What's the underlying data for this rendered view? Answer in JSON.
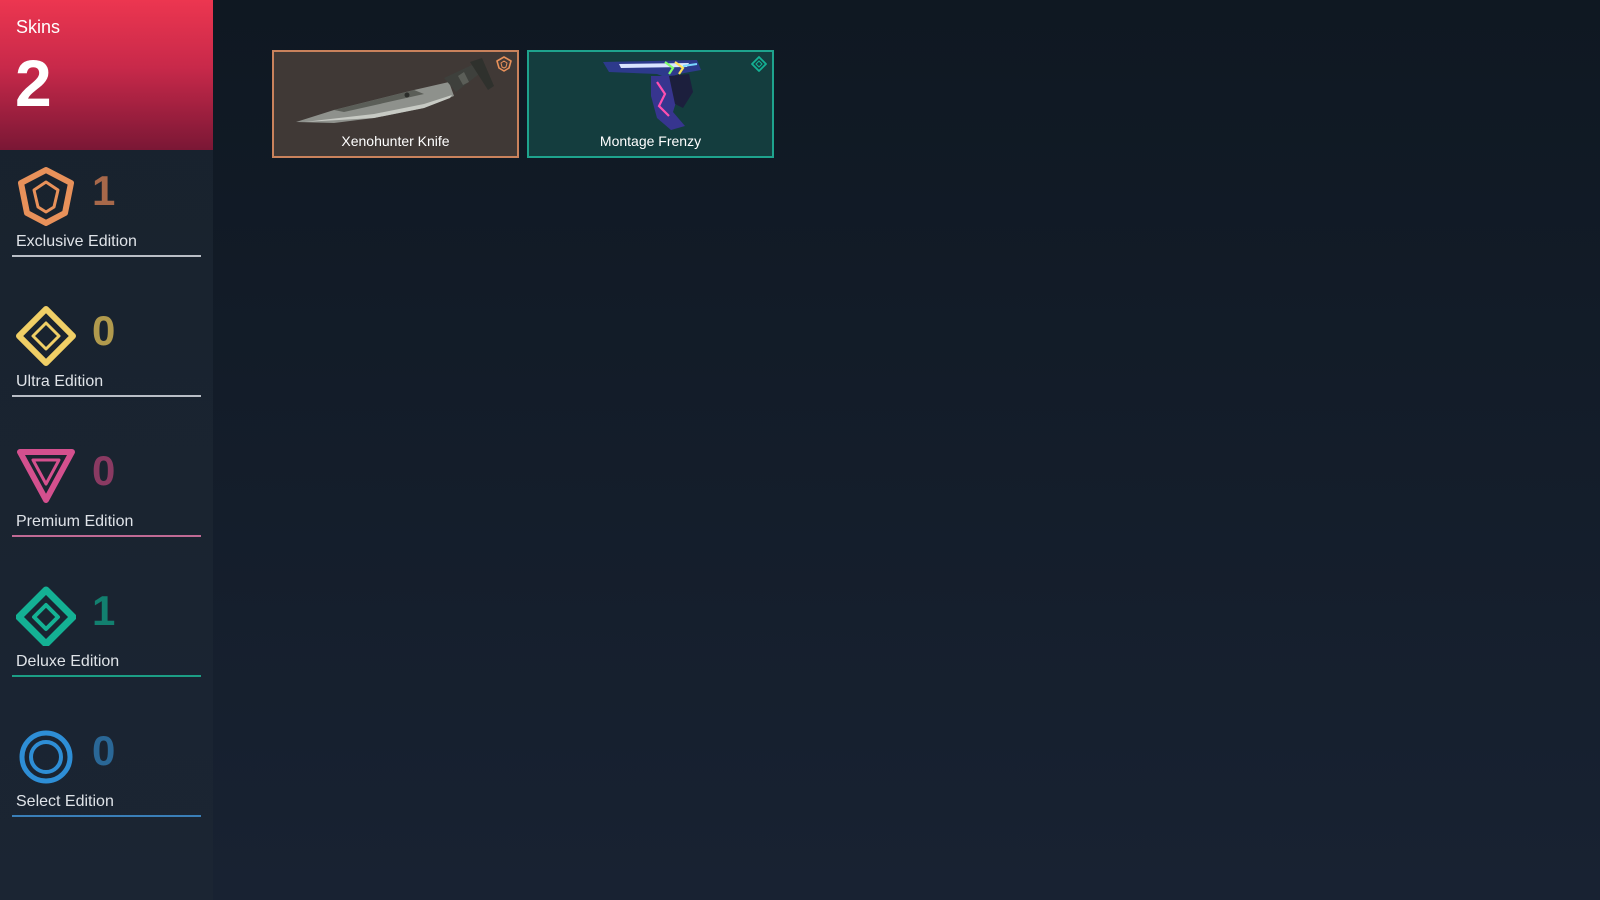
{
  "summary": {
    "label": "Skins",
    "count": "2"
  },
  "tiers": [
    {
      "label": "Exclusive Edition",
      "count": "1",
      "icon": "exclusive-edition-icon",
      "color": "#e8915a",
      "count_color": "#a7684a",
      "rule_color": "#b9bec6"
    },
    {
      "label": "Ultra Edition",
      "count": "0",
      "icon": "ultra-edition-icon",
      "color": "#f0cf66",
      "count_color": "#b19a4d",
      "rule_color": "#b9bec6"
    },
    {
      "label": "Premium Edition",
      "count": "0",
      "icon": "premium-edition-icon",
      "color": "#d4508e",
      "count_color": "#8a3a62",
      "rule_color": "#c06a94"
    },
    {
      "label": "Deluxe Edition",
      "count": "1",
      "icon": "deluxe-edition-icon",
      "color": "#14b194",
      "count_color": "#12806f",
      "rule_color": "#1c9e85"
    },
    {
      "label": "Select Edition",
      "count": "0",
      "icon": "select-edition-icon",
      "color": "#2e8ed6",
      "count_color": "#2a6796",
      "rule_color": "#3a7fb8"
    }
  ],
  "skins": [
    {
      "name": "Xenohunter Knife",
      "tier_icon": "exclusive-edition-icon",
      "image": "knife-image",
      "bg": "#403936",
      "border": "#c9825c"
    },
    {
      "name": "Montage Frenzy",
      "tier_icon": "deluxe-edition-icon",
      "image": "pistol-image",
      "bg": "#143d3e",
      "border": "#1ea38d"
    }
  ]
}
